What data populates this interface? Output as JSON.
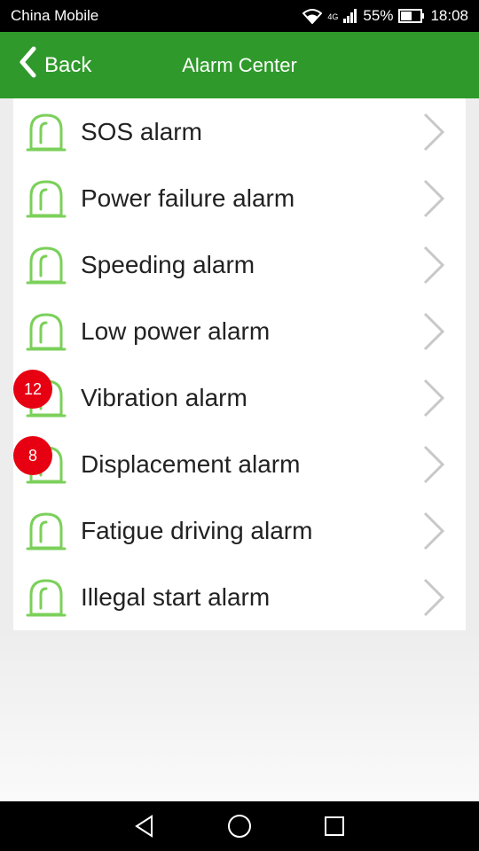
{
  "status": {
    "carrier": "China Mobile",
    "network": "4G",
    "battery": "55%",
    "time": "18:08"
  },
  "header": {
    "back_label": "Back",
    "title": "Alarm Center"
  },
  "alarms": [
    {
      "label": "SOS alarm",
      "badge": null
    },
    {
      "label": "Power failure alarm",
      "badge": null
    },
    {
      "label": "Speeding alarm",
      "badge": null
    },
    {
      "label": "Low power alarm",
      "badge": null
    },
    {
      "label": "Vibration alarm",
      "badge": "12"
    },
    {
      "label": "Displacement alarm",
      "badge": "8"
    },
    {
      "label": "Fatigue driving alarm",
      "badge": null
    },
    {
      "label": "Illegal start alarm",
      "badge": null
    }
  ],
  "colors": {
    "header_green": "#2f9a2b",
    "icon_green": "#7bd05a",
    "badge_red": "#e60012"
  },
  "icons": {
    "alarm": "siren-icon",
    "chevron": "chevron-right-icon"
  }
}
